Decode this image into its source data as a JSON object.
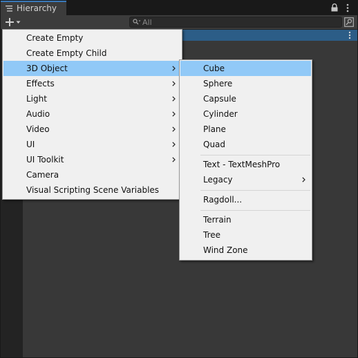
{
  "window": {
    "tab_title": "Hierarchy",
    "lock_icon": "lock-icon",
    "menu_icon": "kebab-menu-icon"
  },
  "toolbar": {
    "add_icon": "plus-icon",
    "dropdown_icon": "chevron-down-icon",
    "search_placeholder": "All",
    "search_icon": "search-icon",
    "scene_search_icon": "scene-search-icon"
  },
  "create_menu": {
    "items": [
      {
        "label": "Create Empty",
        "submenu": false,
        "selected": false
      },
      {
        "label": "Create Empty Child",
        "submenu": false,
        "selected": false
      },
      {
        "label": "3D Object",
        "submenu": true,
        "selected": true
      },
      {
        "label": "Effects",
        "submenu": true,
        "selected": false
      },
      {
        "label": "Light",
        "submenu": true,
        "selected": false
      },
      {
        "label": "Audio",
        "submenu": true,
        "selected": false
      },
      {
        "label": "Video",
        "submenu": true,
        "selected": false
      },
      {
        "label": "UI",
        "submenu": true,
        "selected": false
      },
      {
        "label": "UI Toolkit",
        "submenu": true,
        "selected": false
      },
      {
        "label": "Camera",
        "submenu": false,
        "selected": false
      },
      {
        "label": "Visual Scripting Scene Variables",
        "submenu": false,
        "selected": false
      }
    ]
  },
  "object_3d_menu": {
    "items": [
      {
        "label": "Cube",
        "submenu": false,
        "selected": true
      },
      {
        "label": "Sphere",
        "submenu": false,
        "selected": false
      },
      {
        "label": "Capsule",
        "submenu": false,
        "selected": false
      },
      {
        "label": "Cylinder",
        "submenu": false,
        "selected": false
      },
      {
        "label": "Plane",
        "submenu": false,
        "selected": false
      },
      {
        "label": "Quad",
        "submenu": false,
        "selected": false
      },
      {
        "label": "Text - TextMeshPro",
        "submenu": false,
        "selected": false
      },
      {
        "label": "Legacy",
        "submenu": true,
        "selected": false
      },
      {
        "label": "Ragdoll...",
        "submenu": false,
        "selected": false
      },
      {
        "label": "Terrain",
        "submenu": false,
        "selected": false
      },
      {
        "label": "Tree",
        "submenu": false,
        "selected": false
      },
      {
        "label": "Wind Zone",
        "submenu": false,
        "selected": false
      }
    ]
  },
  "colors": {
    "selection_highlight": "#91c9f7",
    "scene_row": "#2c5d87",
    "tab_accent": "#3a79bb",
    "menu_bg": "#f0f0f0"
  }
}
